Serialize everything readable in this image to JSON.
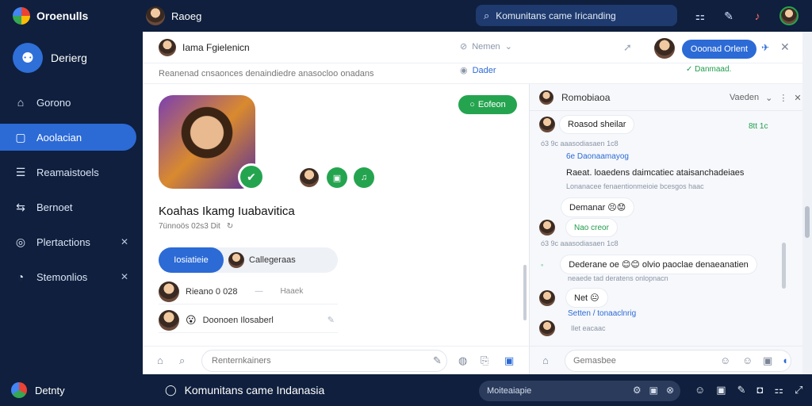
{
  "topbar": {
    "brand_name": "Oroenulls",
    "user_name": "Raoeg",
    "search_text": "Komunitans came Iricanding",
    "icons": [
      "grid-icon",
      "pen-icon",
      "bell-icon",
      "profile-icon"
    ]
  },
  "sidebar": {
    "profile_name": "Derierg",
    "items": [
      {
        "label": "Gorono",
        "icon": "tag-icon",
        "active": false
      },
      {
        "label": "Aoolacian",
        "icon": "window-icon",
        "active": true
      },
      {
        "label": "Reamaistoels",
        "icon": "list-icon",
        "active": false
      },
      {
        "label": "Bernoet",
        "icon": "share-icon",
        "active": false
      },
      {
        "label": "Plertactions",
        "icon": "target-icon",
        "active": false,
        "closable": true
      },
      {
        "label": "Stemonlios",
        "icon": "clock-icon",
        "active": false,
        "closable": true
      }
    ]
  },
  "header": {
    "title": "Iama Fgielenicn",
    "member_select": "Nemen",
    "join_label": "Ooonad Orlent",
    "subtitle": "Reanenad cnsaonces denaindiedre anasocloo onadans",
    "detail_link": "Dader",
    "online_label": "Danmaad."
  },
  "community": {
    "follow_label": "Eofeon",
    "name": "Koahas Ikamg Iuabavitica",
    "meta": "7ünnoös 02s3 Dit",
    "tabs": [
      {
        "label": "Iosiatieie",
        "active": true
      },
      {
        "label": "Callegeraas",
        "active": false
      }
    ],
    "rows": [
      {
        "text": "Rieano 0 028",
        "sub": "Haaek"
      },
      {
        "text": "Doonoen Ilosaberl",
        "sub": ""
      }
    ],
    "comment_placeholder": "Renternkainers"
  },
  "chat": {
    "title": "Romobiaoa",
    "sort_label": "Vaeden",
    "messages": [
      {
        "bubble": "Roasod sheilar",
        "time": "8tt 1c"
      },
      {
        "meta": "ó3 9c aaasodiasaen 1c8"
      },
      {
        "link": "6e Daonaamayog"
      },
      {
        "text": "Raeat. loaedens daimcatiec ataisanchadeiaes"
      },
      {
        "meta2": "Lonanacee fenaentionmeioie bcesgos haac"
      },
      {
        "bubble": "Demanar 😣😟"
      },
      {
        "green": "Nao creor"
      },
      {
        "meta": "ó3 9c aaasodiasaen 1c8"
      },
      {
        "bubble": "Dederane oe 😊😊 olvio paoclae denaeanatien"
      },
      {
        "meta": "neaede tad deratens onlopnacn"
      },
      {
        "bubble": "Net 😐"
      },
      {
        "link": "Setten / tonaaclnrig"
      },
      {
        "meta": "Ilet eacaac"
      }
    ],
    "input_placeholder": "Gemasbee"
  },
  "taskbar": {
    "app_name": "Detnty",
    "title": "Komunitans came Indanasia",
    "search_text": "Moiteaiapie"
  }
}
